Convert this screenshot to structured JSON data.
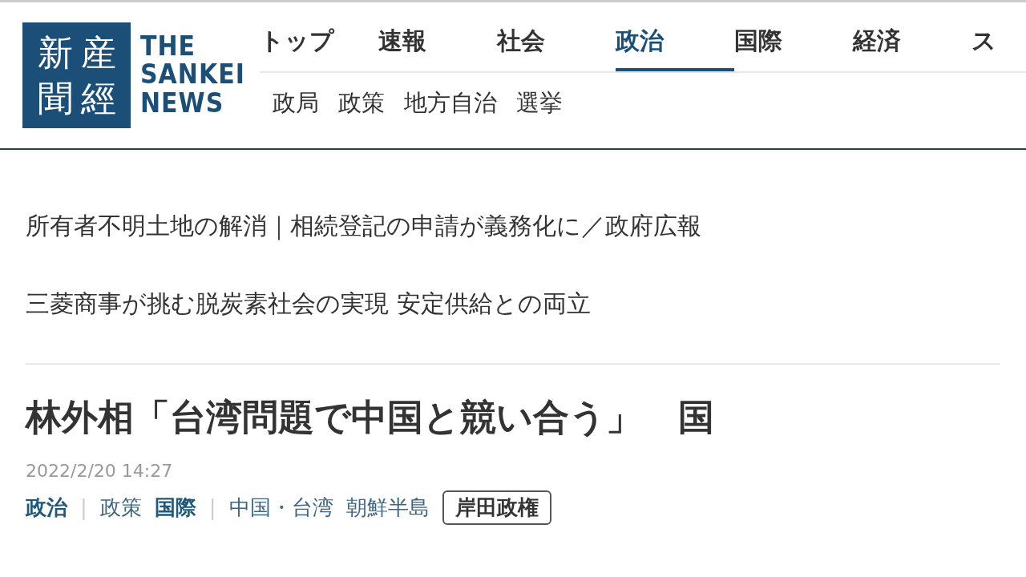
{
  "logo": {
    "kanji_columns": [
      "新聞",
      "産經"
    ],
    "wordmark": [
      "THE",
      "SANKEI",
      "NEWS"
    ]
  },
  "nav_tabs": [
    {
      "label": "トップ",
      "selected": false
    },
    {
      "label": "速報",
      "selected": false
    },
    {
      "label": "社会",
      "selected": false
    },
    {
      "label": "政治",
      "selected": true
    },
    {
      "label": "国際",
      "selected": false
    },
    {
      "label": "経済",
      "selected": false
    },
    {
      "label": "ス",
      "selected": false
    }
  ],
  "sub_nav": [
    "政局",
    "政策",
    "地方自治",
    "選挙"
  ],
  "promo_links": [
    "所有者不明土地の解消｜相続登記の申請が義務化に／政府広報",
    "三菱商事が挑む脱炭素社会の実現 安定供給との両立"
  ],
  "article": {
    "headline": "林外相「台湾問題で中国と競い合う」　国",
    "date": "2022/2/20 14:27",
    "tags": [
      {
        "kind": "category",
        "text": "政治"
      },
      {
        "kind": "separator",
        "text": "|"
      },
      {
        "kind": "subcategory",
        "text": "政策"
      },
      {
        "kind": "category",
        "text": "国際"
      },
      {
        "kind": "separator",
        "text": "|"
      },
      {
        "kind": "subcategory",
        "text": "中国・台湾"
      },
      {
        "kind": "subcategory",
        "text": "朝鮮半島"
      },
      {
        "kind": "topic",
        "text": "岸田政権"
      }
    ]
  }
}
